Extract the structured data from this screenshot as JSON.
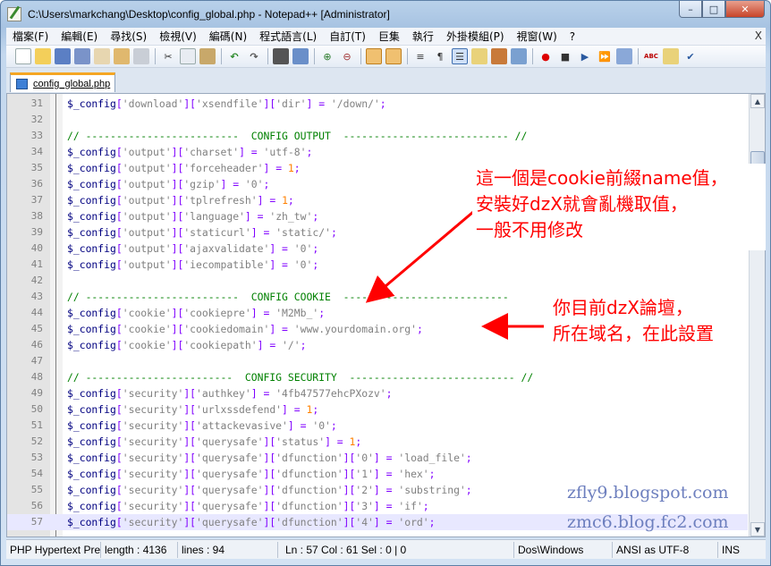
{
  "window": {
    "title": "C:\\Users\\markchang\\Desktop\\config_global.php - Notepad++ [Administrator]",
    "caption_buttons": {
      "minimize": "–",
      "maximize": "□",
      "close": "✕"
    }
  },
  "menu": {
    "items": [
      "檔案(F)",
      "編輯(E)",
      "尋找(S)",
      "檢視(V)",
      "編碼(N)",
      "程式語言(L)",
      "自訂(T)",
      "巨集",
      "執行",
      "外掛模組(P)",
      "視窗(W)",
      "?"
    ],
    "close_glyph": "X"
  },
  "tab": {
    "label": "config_global.php"
  },
  "code_lines": [
    {
      "n": "31",
      "parts": [
        [
          "var",
          "$_config"
        ],
        [
          "op",
          "["
        ],
        [
          "str",
          "'download'"
        ],
        [
          "op",
          "]["
        ],
        [
          "str",
          "'xsendfile'"
        ],
        [
          "op",
          "]["
        ],
        [
          "str",
          "'dir'"
        ],
        [
          "op",
          "] = "
        ],
        [
          "str",
          "'/down/'"
        ],
        [
          "op",
          ";"
        ]
      ]
    },
    {
      "n": "32",
      "parts": []
    },
    {
      "n": "33",
      "parts": [
        [
          "comment",
          "// -------------------------  CONFIG OUTPUT  --------------------------- //"
        ]
      ]
    },
    {
      "n": "34",
      "parts": [
        [
          "var",
          "$_config"
        ],
        [
          "op",
          "["
        ],
        [
          "str",
          "'output'"
        ],
        [
          "op",
          "]["
        ],
        [
          "str",
          "'charset'"
        ],
        [
          "op",
          "] = "
        ],
        [
          "str",
          "'utf-8'"
        ],
        [
          "op",
          ";"
        ]
      ]
    },
    {
      "n": "35",
      "parts": [
        [
          "var",
          "$_config"
        ],
        [
          "op",
          "["
        ],
        [
          "str",
          "'output'"
        ],
        [
          "op",
          "]["
        ],
        [
          "str",
          "'forceheader'"
        ],
        [
          "op",
          "] = "
        ],
        [
          "num",
          "1"
        ],
        [
          "op",
          ";"
        ]
      ]
    },
    {
      "n": "36",
      "parts": [
        [
          "var",
          "$_config"
        ],
        [
          "op",
          "["
        ],
        [
          "str",
          "'output'"
        ],
        [
          "op",
          "]["
        ],
        [
          "str",
          "'gzip'"
        ],
        [
          "op",
          "] = "
        ],
        [
          "str",
          "'0'"
        ],
        [
          "op",
          ";"
        ]
      ]
    },
    {
      "n": "37",
      "parts": [
        [
          "var",
          "$_config"
        ],
        [
          "op",
          "["
        ],
        [
          "str",
          "'output'"
        ],
        [
          "op",
          "]["
        ],
        [
          "str",
          "'tplrefresh'"
        ],
        [
          "op",
          "] = "
        ],
        [
          "num",
          "1"
        ],
        [
          "op",
          ";"
        ]
      ]
    },
    {
      "n": "38",
      "parts": [
        [
          "var",
          "$_config"
        ],
        [
          "op",
          "["
        ],
        [
          "str",
          "'output'"
        ],
        [
          "op",
          "]["
        ],
        [
          "str",
          "'language'"
        ],
        [
          "op",
          "] = "
        ],
        [
          "str",
          "'zh_tw'"
        ],
        [
          "op",
          ";"
        ]
      ]
    },
    {
      "n": "39",
      "parts": [
        [
          "var",
          "$_config"
        ],
        [
          "op",
          "["
        ],
        [
          "str",
          "'output'"
        ],
        [
          "op",
          "]["
        ],
        [
          "str",
          "'staticurl'"
        ],
        [
          "op",
          "] = "
        ],
        [
          "str",
          "'static/'"
        ],
        [
          "op",
          ";"
        ]
      ]
    },
    {
      "n": "40",
      "parts": [
        [
          "var",
          "$_config"
        ],
        [
          "op",
          "["
        ],
        [
          "str",
          "'output'"
        ],
        [
          "op",
          "]["
        ],
        [
          "str",
          "'ajaxvalidate'"
        ],
        [
          "op",
          "] = "
        ],
        [
          "str",
          "'0'"
        ],
        [
          "op",
          ";"
        ]
      ]
    },
    {
      "n": "41",
      "parts": [
        [
          "var",
          "$_config"
        ],
        [
          "op",
          "["
        ],
        [
          "str",
          "'output'"
        ],
        [
          "op",
          "]["
        ],
        [
          "str",
          "'iecompatible'"
        ],
        [
          "op",
          "] = "
        ],
        [
          "str",
          "'0'"
        ],
        [
          "op",
          ";"
        ]
      ]
    },
    {
      "n": "42",
      "parts": []
    },
    {
      "n": "43",
      "parts": [
        [
          "comment",
          "// -------------------------  CONFIG COOKIE  ---------------------------"
        ]
      ]
    },
    {
      "n": "44",
      "parts": [
        [
          "var",
          "$_config"
        ],
        [
          "op",
          "["
        ],
        [
          "str",
          "'cookie'"
        ],
        [
          "op",
          "]["
        ],
        [
          "str",
          "'cookiepre'"
        ],
        [
          "op",
          "] = "
        ],
        [
          "str",
          "'M2Mb_'"
        ],
        [
          "op",
          ";"
        ]
      ]
    },
    {
      "n": "45",
      "parts": [
        [
          "var",
          "$_config"
        ],
        [
          "op",
          "["
        ],
        [
          "str",
          "'cookie'"
        ],
        [
          "op",
          "]["
        ],
        [
          "str",
          "'cookiedomain'"
        ],
        [
          "op",
          "] = "
        ],
        [
          "str",
          "'www.yourdomain.org'"
        ],
        [
          "op",
          ";"
        ]
      ]
    },
    {
      "n": "46",
      "parts": [
        [
          "var",
          "$_config"
        ],
        [
          "op",
          "["
        ],
        [
          "str",
          "'cookie'"
        ],
        [
          "op",
          "]["
        ],
        [
          "str",
          "'cookiepath'"
        ],
        [
          "op",
          "] = "
        ],
        [
          "str",
          "'/'"
        ],
        [
          "op",
          ";"
        ]
      ]
    },
    {
      "n": "47",
      "parts": []
    },
    {
      "n": "48",
      "parts": [
        [
          "comment",
          "// ------------------------  CONFIG SECURITY  --------------------------- //"
        ]
      ]
    },
    {
      "n": "49",
      "parts": [
        [
          "var",
          "$_config"
        ],
        [
          "op",
          "["
        ],
        [
          "str",
          "'security'"
        ],
        [
          "op",
          "]["
        ],
        [
          "str",
          "'authkey'"
        ],
        [
          "op",
          "] = "
        ],
        [
          "str",
          "'4fb47577ehcPXozv'"
        ],
        [
          "op",
          ";"
        ]
      ]
    },
    {
      "n": "50",
      "parts": [
        [
          "var",
          "$_config"
        ],
        [
          "op",
          "["
        ],
        [
          "str",
          "'security'"
        ],
        [
          "op",
          "]["
        ],
        [
          "str",
          "'urlxssdefend'"
        ],
        [
          "op",
          "] = "
        ],
        [
          "num",
          "1"
        ],
        [
          "op",
          ";"
        ]
      ]
    },
    {
      "n": "51",
      "parts": [
        [
          "var",
          "$_config"
        ],
        [
          "op",
          "["
        ],
        [
          "str",
          "'security'"
        ],
        [
          "op",
          "]["
        ],
        [
          "str",
          "'attackevasive'"
        ],
        [
          "op",
          "] = "
        ],
        [
          "str",
          "'0'"
        ],
        [
          "op",
          ";"
        ]
      ]
    },
    {
      "n": "52",
      "parts": [
        [
          "var",
          "$_config"
        ],
        [
          "op",
          "["
        ],
        [
          "str",
          "'security'"
        ],
        [
          "op",
          "]["
        ],
        [
          "str",
          "'querysafe'"
        ],
        [
          "op",
          "]["
        ],
        [
          "str",
          "'status'"
        ],
        [
          "op",
          "] = "
        ],
        [
          "num",
          "1"
        ],
        [
          "op",
          ";"
        ]
      ]
    },
    {
      "n": "53",
      "parts": [
        [
          "var",
          "$_config"
        ],
        [
          "op",
          "["
        ],
        [
          "str",
          "'security'"
        ],
        [
          "op",
          "]["
        ],
        [
          "str",
          "'querysafe'"
        ],
        [
          "op",
          "]["
        ],
        [
          "str",
          "'dfunction'"
        ],
        [
          "op",
          "]["
        ],
        [
          "str",
          "'0'"
        ],
        [
          "op",
          "] = "
        ],
        [
          "str",
          "'load_file'"
        ],
        [
          "op",
          ";"
        ]
      ]
    },
    {
      "n": "54",
      "parts": [
        [
          "var",
          "$_config"
        ],
        [
          "op",
          "["
        ],
        [
          "str",
          "'security'"
        ],
        [
          "op",
          "]["
        ],
        [
          "str",
          "'querysafe'"
        ],
        [
          "op",
          "]["
        ],
        [
          "str",
          "'dfunction'"
        ],
        [
          "op",
          "]["
        ],
        [
          "str",
          "'1'"
        ],
        [
          "op",
          "] = "
        ],
        [
          "str",
          "'hex'"
        ],
        [
          "op",
          ";"
        ]
      ]
    },
    {
      "n": "55",
      "parts": [
        [
          "var",
          "$_config"
        ],
        [
          "op",
          "["
        ],
        [
          "str",
          "'security'"
        ],
        [
          "op",
          "]["
        ],
        [
          "str",
          "'querysafe'"
        ],
        [
          "op",
          "]["
        ],
        [
          "str",
          "'dfunction'"
        ],
        [
          "op",
          "]["
        ],
        [
          "str",
          "'2'"
        ],
        [
          "op",
          "] = "
        ],
        [
          "str",
          "'substring'"
        ],
        [
          "op",
          ";"
        ]
      ]
    },
    {
      "n": "56",
      "parts": [
        [
          "var",
          "$_config"
        ],
        [
          "op",
          "["
        ],
        [
          "str",
          "'security'"
        ],
        [
          "op",
          "]["
        ],
        [
          "str",
          "'querysafe'"
        ],
        [
          "op",
          "]["
        ],
        [
          "str",
          "'dfunction'"
        ],
        [
          "op",
          "]["
        ],
        [
          "str",
          "'3'"
        ],
        [
          "op",
          "] = "
        ],
        [
          "str",
          "'if'"
        ],
        [
          "op",
          ";"
        ]
      ]
    },
    {
      "n": "57",
      "current": true,
      "parts": [
        [
          "var",
          "$_config"
        ],
        [
          "op",
          "["
        ],
        [
          "str",
          "'security'"
        ],
        [
          "op",
          "]["
        ],
        [
          "str",
          "'querysafe'"
        ],
        [
          "op",
          "]["
        ],
        [
          "str",
          "'dfunction'"
        ],
        [
          "op",
          "]["
        ],
        [
          "str",
          "'4'"
        ],
        [
          "op",
          "] = "
        ],
        [
          "str",
          "'ord'"
        ],
        [
          "op",
          ";"
        ]
      ]
    }
  ],
  "annotations": {
    "note1": [
      "這一個是cookie前綴name值，",
      "安裝好dzX就會亂機取值，",
      "一般不用修改"
    ],
    "note2": [
      "你目前dzX論壇，",
      "所在域名，在此設置"
    ],
    "watermark1": "zfly9.blogspot.com",
    "watermark2": "zmc6.blog.fc2.com",
    "color": "#ff0000"
  },
  "statusbar": {
    "language": "PHP Hypertext Pre",
    "length": "length : 4136",
    "lines": "lines : 94",
    "position": "Ln : 57   Col : 61   Sel : 0 | 0",
    "eol": "Dos\\Windows",
    "encoding": "ANSI as UTF-8",
    "mode": "INS"
  }
}
